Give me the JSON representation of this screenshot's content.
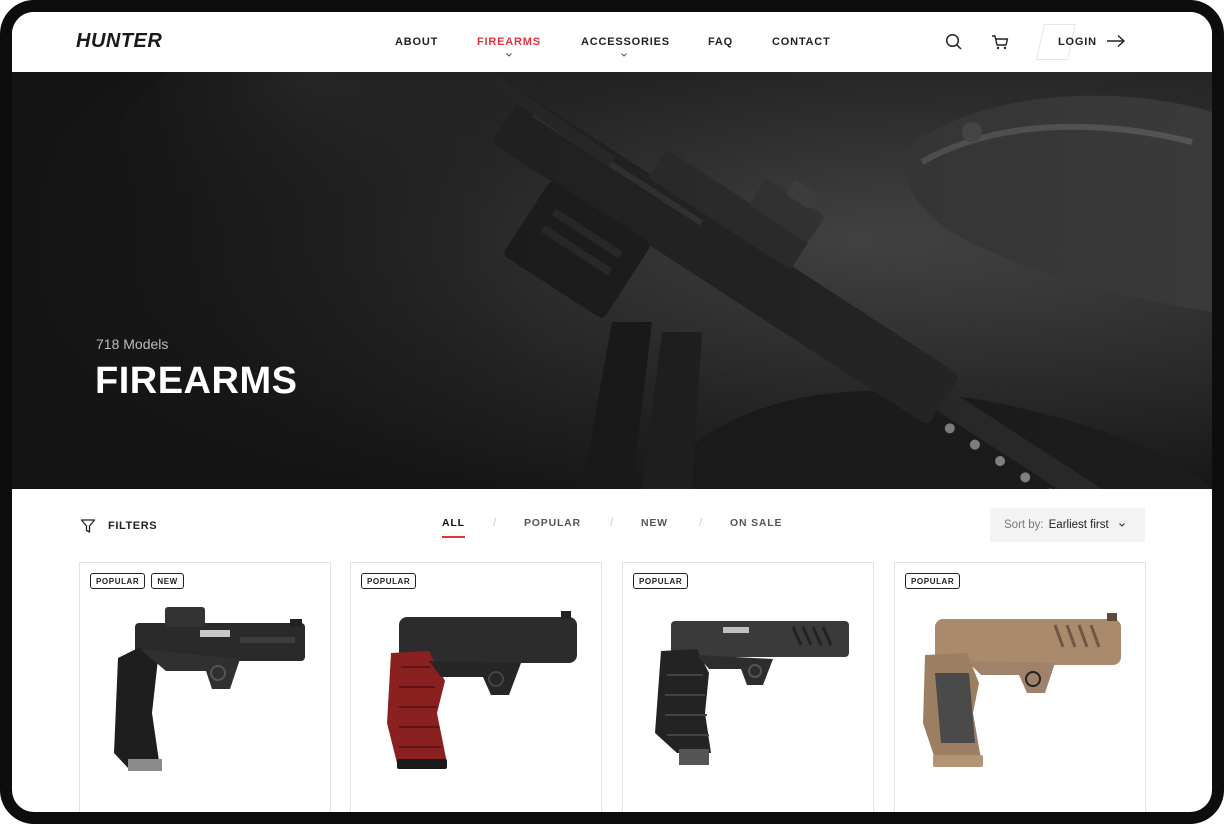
{
  "header": {
    "logo": "HUNTER",
    "nav": [
      {
        "label": "ABOUT",
        "active": false,
        "has_dropdown": false
      },
      {
        "label": "FIREARMS",
        "active": true,
        "has_dropdown": true
      },
      {
        "label": "ACCESSORIES",
        "active": false,
        "has_dropdown": true
      },
      {
        "label": "FAQ",
        "active": false,
        "has_dropdown": false
      },
      {
        "label": "CONTACT",
        "active": false,
        "has_dropdown": false
      }
    ],
    "icons": [
      "search-icon",
      "cart-icon",
      "arrow-right-icon"
    ],
    "login_label": "LOGIN"
  },
  "hero": {
    "count": "718 Models",
    "title": "FIREARMS"
  },
  "toolbar": {
    "filters_label": "FILTERS",
    "tabs": [
      {
        "label": "ALL",
        "active": true
      },
      {
        "label": "POPULAR",
        "active": false
      },
      {
        "label": "NEW",
        "active": false
      },
      {
        "label": "ON SALE",
        "active": false
      }
    ],
    "separator": "/",
    "sort_prefix": "Sort by:",
    "sort_value": "Earliest first"
  },
  "products": [
    {
      "badges": [
        "POPULAR",
        "NEW"
      ],
      "finish": "black"
    },
    {
      "badges": [
        "POPULAR"
      ],
      "finish": "black-red-grip"
    },
    {
      "badges": [
        "POPULAR"
      ],
      "finish": "black-grey"
    },
    {
      "badges": [
        "POPULAR"
      ],
      "finish": "tan"
    }
  ],
  "colors": {
    "accent": "#e3323c",
    "text": "#222222",
    "hero_dark": "#151515",
    "tan": "#a98a6c"
  }
}
